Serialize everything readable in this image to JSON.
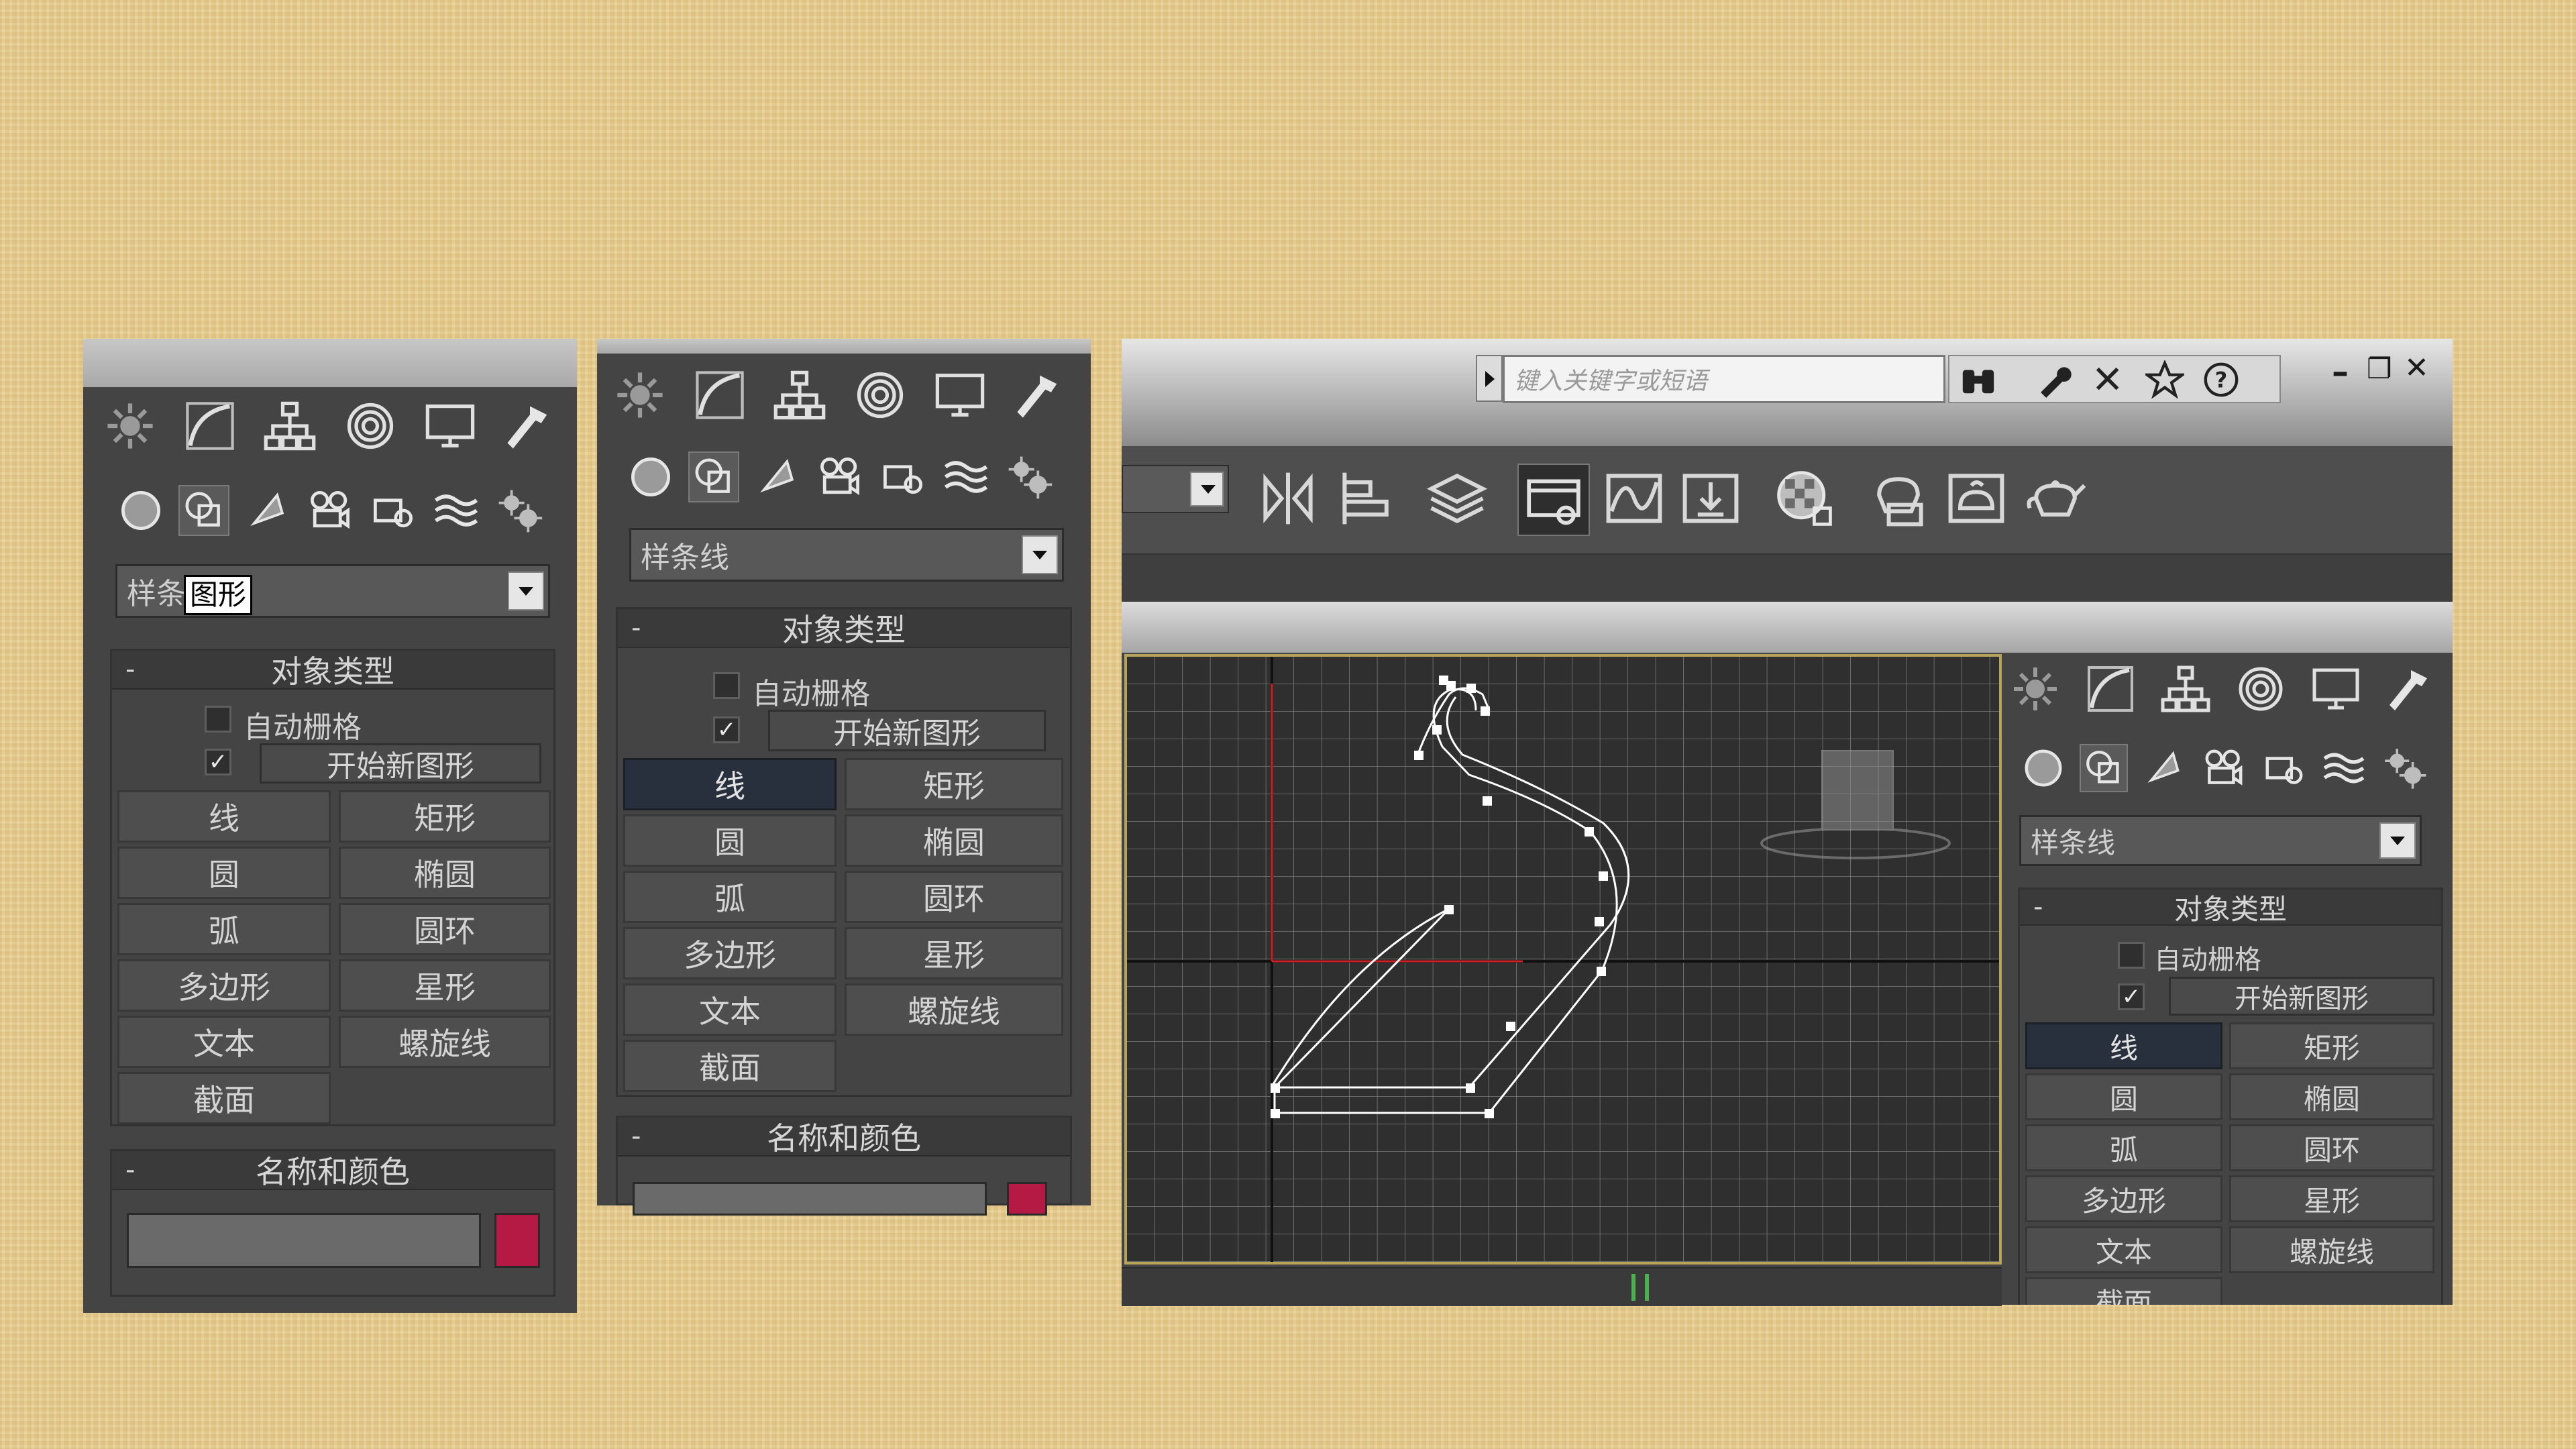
{
  "shared": {
    "dropdown_value": "样条线",
    "rollout_object_type": "对象类型",
    "rollout_name_color": "名称和颜色",
    "minus": "-",
    "auto_grid": "自动栅格",
    "start_new_shape": "开始新图形",
    "check_mark": "✓",
    "buttons": {
      "line": "线",
      "rectangle": "矩形",
      "circle": "圆",
      "ellipse": "椭圆",
      "arc": "弧",
      "donut": "圆环",
      "ngon": "多边形",
      "star": "星形",
      "text": "文本",
      "helix": "螺旋线",
      "section": "截面"
    },
    "colors": {
      "accent": "#b51a45",
      "panel": "#444444",
      "selected": "#27303c"
    }
  },
  "panel1": {
    "dropdown_visible": "样条",
    "tooltip": "图形"
  },
  "window": {
    "search_placeholder": "键入关键字或短语",
    "minimize": "–",
    "restore": "❐",
    "close": "✕"
  },
  "icons": [
    "sun-icon",
    "curve-icon",
    "hierarchy-icon",
    "motion-icon",
    "display-icon",
    "hammer-icon",
    "sphere-icon",
    "shapes-icon",
    "light-icon",
    "camera-icon",
    "helper-icon",
    "spacewarp-icon",
    "systems-icon"
  ]
}
